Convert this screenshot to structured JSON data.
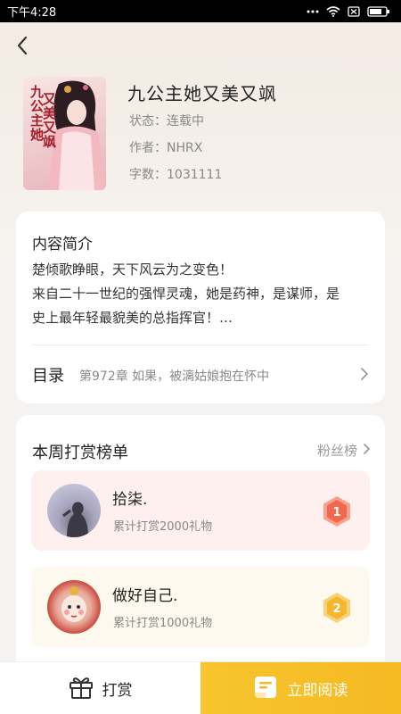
{
  "status_bar": {
    "time": "下午4:28",
    "icons": [
      "signal-dots-icon",
      "wifi-icon",
      "battery-icon"
    ]
  },
  "nav": {
    "back_icon": "chevron-left-icon"
  },
  "book": {
    "cover_title": "九公主她又美又飒",
    "title": "九公主她又美又飒",
    "status": "状态：连载中",
    "author": "作者：NHRX",
    "word_count": "字数：1031111"
  },
  "intro": {
    "heading": "内容简介",
    "line1": "楚倾歌睁眼，天下风云为之变色！",
    "line2": "来自二十一世纪的强悍灵魂，她是药神，是谋师，是",
    "line3": "史上最年轻最貌美的总指挥官！…",
    "toc_label": "目录",
    "latest_chapter": "第972章 如果，被漓姑娘抱在怀中"
  },
  "ranking": {
    "title": "本周打赏榜单",
    "fans_link": "粉丝榜",
    "items": [
      {
        "name": "拾柒.",
        "gift": "累计打赏2000礼物",
        "rank": "1",
        "badge_color": "#f2674f"
      },
      {
        "name": "做好自己.",
        "gift": "累计打赏1000礼物",
        "rank": "2",
        "badge_color": "#f3b62c"
      }
    ]
  },
  "bottom": {
    "tip_label": "打赏",
    "read_label": "立即阅读"
  },
  "colors": {
    "accent": "#f7c52f",
    "rank1_bg": "#fdf0ef",
    "rank2_bg": "#fdf9ee"
  }
}
